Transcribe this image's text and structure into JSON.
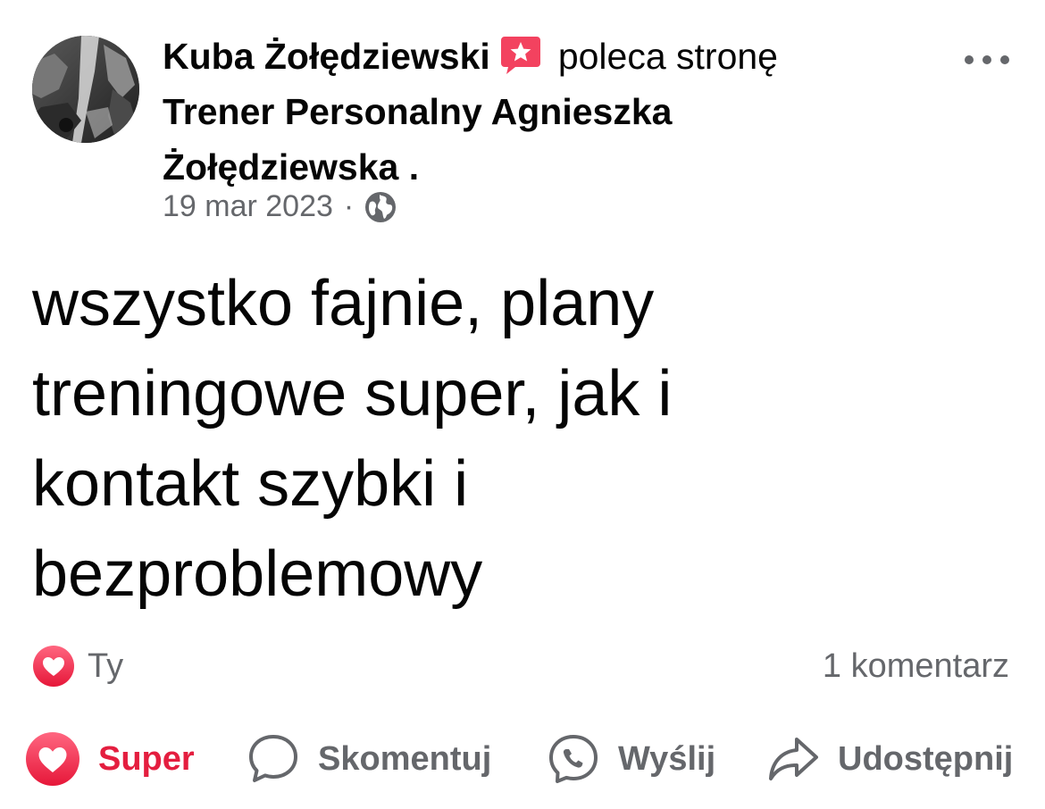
{
  "post": {
    "author": "Kuba Żołędziewski",
    "verb": "poleca stronę",
    "page_name": "Trener Personalny Agnieszka Żołędziewska",
    "page_suffix": ".",
    "date": "19 mar 2023",
    "separator": "·",
    "visibility_icon": "globe-icon",
    "recommend_icon": "recommendation-star-icon",
    "body": "wszystko fajnie, plany treningowe super, jak i kontakt szybki i bezproblemowy"
  },
  "reactions": {
    "icon": "heart-reaction-icon",
    "label": "Ty"
  },
  "comments": {
    "label": "1 komentarz"
  },
  "actions": [
    {
      "label": "Super",
      "icon": "heart-icon",
      "active": true
    },
    {
      "label": "Skomentuj",
      "icon": "comment-bubble-icon",
      "active": false
    },
    {
      "label": "Wyślij",
      "icon": "messenger-send-icon",
      "active": false
    },
    {
      "label": "Udostępnij",
      "icon": "share-arrow-icon",
      "active": false
    }
  ],
  "colors": {
    "accent_red": "#e41e3f",
    "text_primary": "#050505",
    "text_secondary": "#65676b",
    "recommend_badge": "#f3425f"
  }
}
